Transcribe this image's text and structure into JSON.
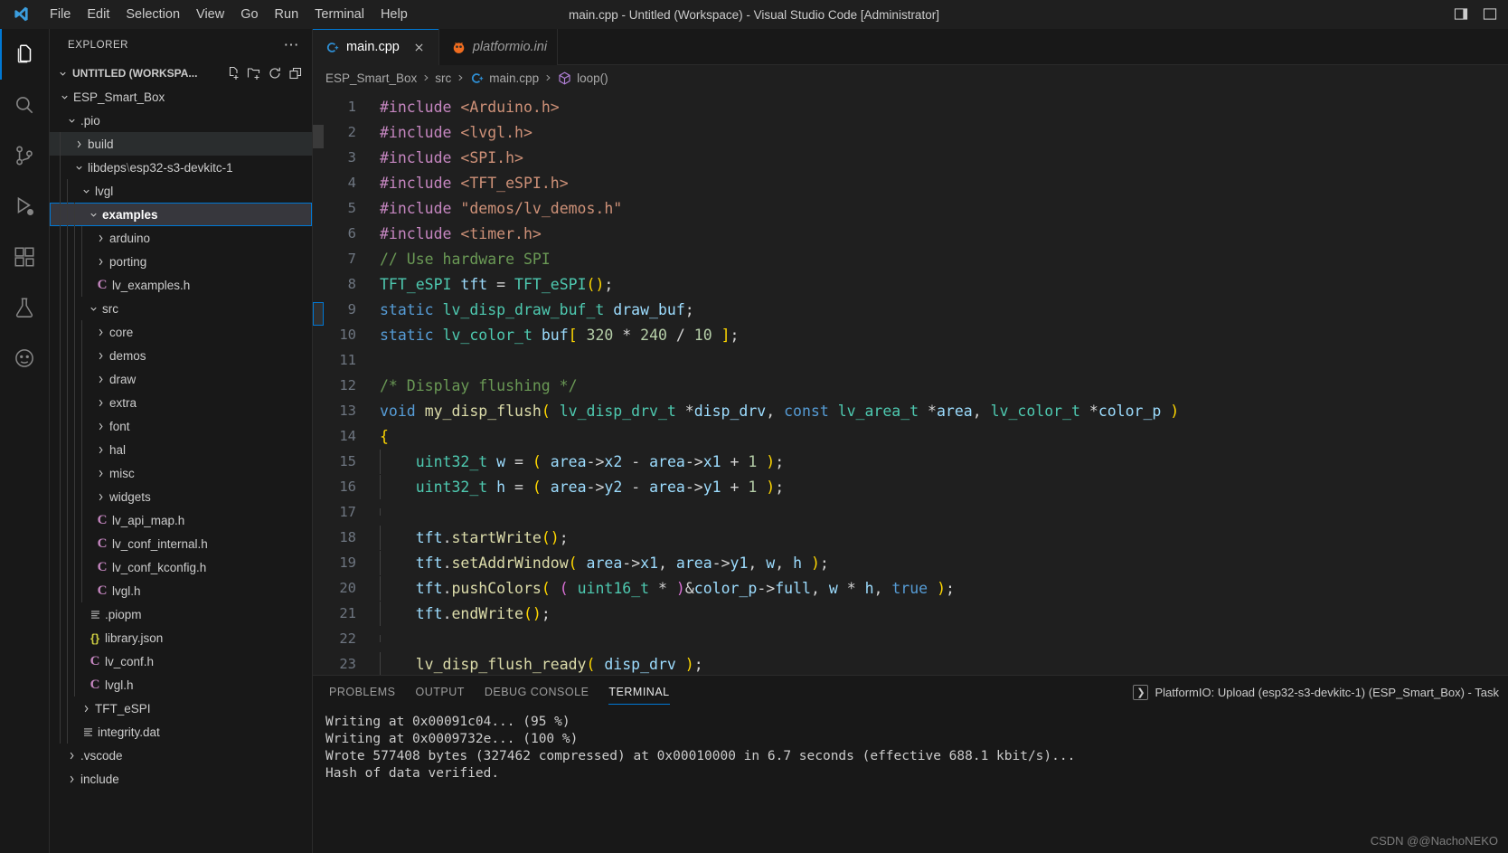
{
  "window": {
    "title": "main.cpp - Untitled (Workspace) - Visual Studio Code [Administrator]",
    "menus": [
      "File",
      "Edit",
      "Selection",
      "View",
      "Go",
      "Run",
      "Terminal",
      "Help"
    ]
  },
  "activitybar": {
    "items": [
      {
        "name": "explorer",
        "icon": "files-icon",
        "active": true
      },
      {
        "name": "search",
        "icon": "search-icon",
        "active": false
      },
      {
        "name": "source-control",
        "icon": "source-control-icon",
        "active": false
      },
      {
        "name": "run-and-debug",
        "icon": "run-debug-icon",
        "active": false
      },
      {
        "name": "extensions",
        "icon": "extensions-icon",
        "active": false
      },
      {
        "name": "testing",
        "icon": "beaker-icon",
        "active": false
      },
      {
        "name": "platformio",
        "icon": "alien-icon",
        "active": false
      },
      {
        "name": "remote-explorer",
        "icon": "remote-icon",
        "active": false
      }
    ]
  },
  "sidebar": {
    "title": "EXPLORER",
    "workspace_label": "UNTITLED (WORKSPA...",
    "actions": [
      "new-file-icon",
      "new-folder-icon",
      "refresh-icon",
      "collapse-all-icon"
    ],
    "tree": [
      {
        "label": "ESP_Smart_Box",
        "depth": 0,
        "kind": "folder",
        "state": "expanded",
        "selected": false
      },
      {
        "label": ".pio",
        "depth": 1,
        "kind": "folder",
        "state": "expanded",
        "selected": false
      },
      {
        "label": "build",
        "depth": 2,
        "kind": "folder",
        "state": "collapsed",
        "selected": false,
        "hover": true
      },
      {
        "label": "libdeps\\esp32-s3-devkitc-1",
        "depth": 2,
        "kind": "folder",
        "state": "expanded",
        "selected": false
      },
      {
        "label": "lvgl",
        "depth": 3,
        "kind": "folder",
        "state": "expanded",
        "selected": false
      },
      {
        "label": "examples",
        "depth": 4,
        "kind": "folder",
        "state": "expanded",
        "selected": true
      },
      {
        "label": "arduino",
        "depth": 5,
        "kind": "folder",
        "state": "collapsed",
        "selected": false
      },
      {
        "label": "porting",
        "depth": 5,
        "kind": "folder",
        "state": "collapsed",
        "selected": false
      },
      {
        "label": "lv_examples.h",
        "depth": 5,
        "kind": "c-header",
        "state": "none",
        "selected": false
      },
      {
        "label": "src",
        "depth": 4,
        "kind": "folder",
        "state": "expanded",
        "selected": false
      },
      {
        "label": "core",
        "depth": 5,
        "kind": "folder",
        "state": "collapsed",
        "selected": false
      },
      {
        "label": "demos",
        "depth": 5,
        "kind": "folder",
        "state": "collapsed",
        "selected": false
      },
      {
        "label": "draw",
        "depth": 5,
        "kind": "folder",
        "state": "collapsed",
        "selected": false
      },
      {
        "label": "extra",
        "depth": 5,
        "kind": "folder",
        "state": "collapsed",
        "selected": false
      },
      {
        "label": "font",
        "depth": 5,
        "kind": "folder",
        "state": "collapsed",
        "selected": false
      },
      {
        "label": "hal",
        "depth": 5,
        "kind": "folder",
        "state": "collapsed",
        "selected": false
      },
      {
        "label": "misc",
        "depth": 5,
        "kind": "folder",
        "state": "collapsed",
        "selected": false
      },
      {
        "label": "widgets",
        "depth": 5,
        "kind": "folder",
        "state": "collapsed",
        "selected": false
      },
      {
        "label": "lv_api_map.h",
        "depth": 5,
        "kind": "c-header",
        "state": "none",
        "selected": false
      },
      {
        "label": "lv_conf_internal.h",
        "depth": 5,
        "kind": "c-header",
        "state": "none",
        "selected": false
      },
      {
        "label": "lv_conf_kconfig.h",
        "depth": 5,
        "kind": "c-header",
        "state": "none",
        "selected": false
      },
      {
        "label": "lvgl.h",
        "depth": 5,
        "kind": "c-header",
        "state": "none",
        "selected": false
      },
      {
        "label": ".piopm",
        "depth": 4,
        "kind": "data",
        "state": "none",
        "selected": false
      },
      {
        "label": "library.json",
        "depth": 4,
        "kind": "json",
        "state": "none",
        "selected": false
      },
      {
        "label": "lv_conf.h",
        "depth": 4,
        "kind": "c-header",
        "state": "none",
        "selected": false
      },
      {
        "label": "lvgl.h",
        "depth": 4,
        "kind": "c-header",
        "state": "none",
        "selected": false
      },
      {
        "label": "TFT_eSPI",
        "depth": 3,
        "kind": "folder",
        "state": "collapsed",
        "selected": false
      },
      {
        "label": "integrity.dat",
        "depth": 3,
        "kind": "data",
        "state": "none",
        "selected": false
      },
      {
        "label": ".vscode",
        "depth": 1,
        "kind": "folder",
        "state": "collapsed",
        "selected": false
      },
      {
        "label": "include",
        "depth": 1,
        "kind": "folder",
        "state": "collapsed",
        "selected": false
      }
    ]
  },
  "editor": {
    "tabs": [
      {
        "label": "main.cpp",
        "icon": "cpp-icon",
        "active": true,
        "preview": false,
        "closable": true
      },
      {
        "label": "platformio.ini",
        "icon": "platformio-icon",
        "active": false,
        "preview": true,
        "closable": false
      }
    ],
    "breadcrumb": [
      {
        "label": "ESP_Smart_Box",
        "icon": ""
      },
      {
        "label": "src",
        "icon": ""
      },
      {
        "label": "main.cpp",
        "icon": "cpp-icon"
      },
      {
        "label": "loop()",
        "icon": "symbol-method-icon"
      }
    ],
    "code_lines": [
      {
        "n": 1,
        "text": "#include <Arduino.h>"
      },
      {
        "n": 2,
        "text": "#include <lvgl.h>"
      },
      {
        "n": 3,
        "text": "#include <SPI.h>"
      },
      {
        "n": 4,
        "text": "#include <TFT_eSPI.h>"
      },
      {
        "n": 5,
        "text": "#include \"demos/lv_demos.h\""
      },
      {
        "n": 6,
        "text": "#include <timer.h>"
      },
      {
        "n": 7,
        "text": "// Use hardware SPI"
      },
      {
        "n": 8,
        "text": "TFT_eSPI tft = TFT_eSPI();"
      },
      {
        "n": 9,
        "text": "static lv_disp_draw_buf_t draw_buf;"
      },
      {
        "n": 10,
        "text": "static lv_color_t buf[ 320 * 240 / 10 ];"
      },
      {
        "n": 11,
        "text": ""
      },
      {
        "n": 12,
        "text": "/* Display flushing */"
      },
      {
        "n": 13,
        "text": "void my_disp_flush( lv_disp_drv_t *disp_drv, const lv_area_t *area, lv_color_t *color_p )"
      },
      {
        "n": 14,
        "text": "{"
      },
      {
        "n": 15,
        "text": "    uint32_t w = ( area->x2 - area->x1 + 1 );"
      },
      {
        "n": 16,
        "text": "    uint32_t h = ( area->y2 - area->y1 + 1 );"
      },
      {
        "n": 17,
        "text": ""
      },
      {
        "n": 18,
        "text": "    tft.startWrite();"
      },
      {
        "n": 19,
        "text": "    tft.setAddrWindow( area->x1, area->y1, w, h );"
      },
      {
        "n": 20,
        "text": "    tft.pushColors( ( uint16_t * )&color_p->full, w * h, true );"
      },
      {
        "n": 21,
        "text": "    tft.endWrite();"
      },
      {
        "n": 22,
        "text": ""
      },
      {
        "n": 23,
        "text": "    lv_disp_flush_ready( disp_drv );"
      }
    ]
  },
  "panel": {
    "tabs": [
      {
        "label": "PROBLEMS",
        "active": false
      },
      {
        "label": "OUTPUT",
        "active": false
      },
      {
        "label": "DEBUG CONSOLE",
        "active": false
      },
      {
        "label": "TERMINAL",
        "active": true
      }
    ],
    "terminal_selector": "PlatformIO: Upload (esp32-s3-devkitc-1) (ESP_Smart_Box) - Task",
    "terminal_lines": [
      "Writing at 0x00091c04... (95 %)",
      "Writing at 0x0009732e... (100 %)",
      "Wrote 577408 bytes (327462 compressed) at 0x00010000 in 6.7 seconds (effective 688.1 kbit/s)...",
      "Hash of data verified."
    ]
  },
  "watermark": "CSDN @@NachoNEKO",
  "colors": {
    "accent": "#0078d4",
    "editor_bg": "#1f1f1f",
    "sidebar_bg": "#181818",
    "selection_bg": "#37373d"
  }
}
